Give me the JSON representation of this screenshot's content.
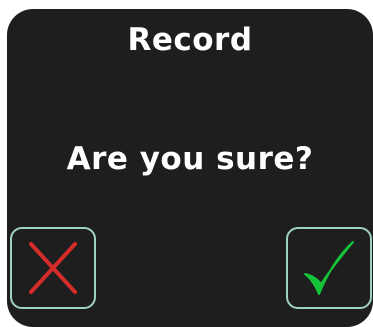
{
  "dialog": {
    "title": "Record",
    "message": "Are you sure?",
    "cancel_icon": "x-icon",
    "confirm_icon": "checkmark-icon"
  },
  "colors": {
    "background": "#1e1e1e",
    "text": "#ffffff",
    "button_border": "#9ed3c6",
    "cancel": "#d42b2b",
    "confirm": "#16c43a"
  }
}
